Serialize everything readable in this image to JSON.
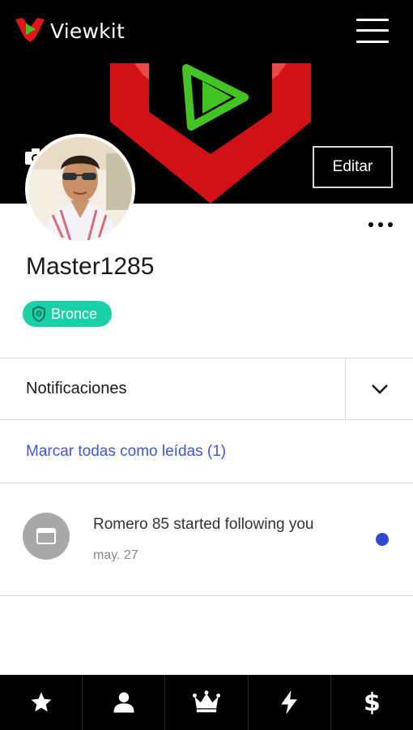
{
  "header": {
    "brand": "Viewkit",
    "logo_icon": "viewkit-logo-icon",
    "menu_icon": "hamburger-menu-icon"
  },
  "cover": {
    "camera_icon": "camera-icon",
    "edit_label": "Editar"
  },
  "profile": {
    "username": "Master1285",
    "badge_label": "Bronce",
    "badge_icon": "shield-icon",
    "badge_color": "#1ad0a6",
    "more_icon": "more-options-icon"
  },
  "notifications": {
    "title": "Notificaciones",
    "toggle_icon": "chevron-down-icon",
    "mark_all_label": "Marcar todas como leídas (1)",
    "items": [
      {
        "text": "Romero 85 started following you",
        "date": "may. 27",
        "icon": "browser-window-icon",
        "unread": true
      }
    ]
  },
  "bottom_nav": {
    "items": [
      {
        "icon": "star-icon"
      },
      {
        "icon": "user-icon"
      },
      {
        "icon": "crown-icon"
      },
      {
        "icon": "lightning-icon"
      },
      {
        "icon": "dollar-icon",
        "label": "$"
      }
    ]
  },
  "colors": {
    "accent_red": "#e0161b",
    "accent_green": "#44c424",
    "link_blue": "#3f57d8",
    "unread_dot": "#2e48d4"
  }
}
